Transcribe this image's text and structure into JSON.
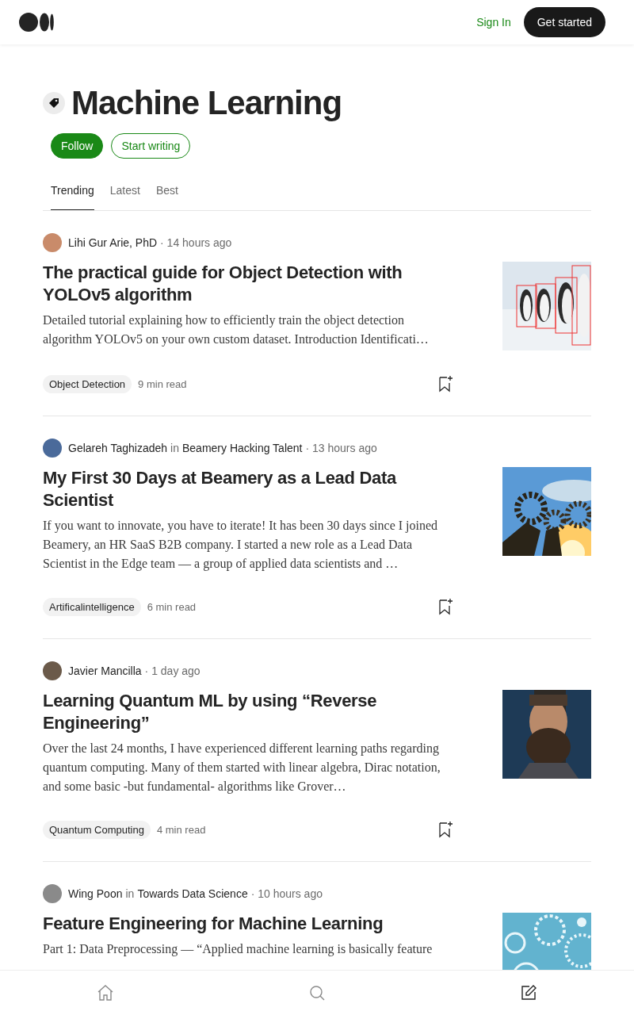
{
  "header": {
    "sign_in": "Sign In",
    "get_started": "Get started"
  },
  "topic": {
    "title": "Machine Learning",
    "follow": "Follow",
    "start_writing": "Start writing"
  },
  "tabs": [
    {
      "label": "Trending",
      "selected": true
    },
    {
      "label": "Latest",
      "selected": false
    },
    {
      "label": "Best",
      "selected": false
    }
  ],
  "articles": [
    {
      "author": "Lihi Gur Arie, PhD",
      "time": "· 14 hours ago",
      "title": "The practical guide for Object Detection with YOLOv5 algorithm",
      "excerpt": "Detailed tutorial explaining how to efficiently train the object detection algorithm YOLOv5 on your own custom dataset. Introduction Identificati…",
      "tag": "Object Detection",
      "read_time": "9 min read"
    },
    {
      "author": "Gelareh Taghizadeh",
      "in_label": "in",
      "publication": "Beamery Hacking Talent",
      "time": "· 13 hours ago",
      "title": "My First 30 Days at Beamery as a Lead Data Scientist",
      "excerpt": "If you want to innovate, you have to iterate! It has been 30 days since I joined Beamery, an HR SaaS B2B company. I started a new role as a Lead Data Scientist in the Edge team — a group of applied data scientists and …",
      "tag": "Artificalintelligence",
      "read_time": "6 min read"
    },
    {
      "author": "Javier Mancilla",
      "time": "· 1 day ago",
      "title": "Learning Quantum ML by using “Reverse Engineering”",
      "excerpt": "Over the last 24 months, I have experienced different learning paths regarding quantum computing. Many of them started with linear algebra, Dirac notation, and some basic -but fundamental- algorithms like Grover…",
      "tag": "Quantum Computing",
      "read_time": "4 min read"
    },
    {
      "author": "Wing Poon",
      "in_label": "in",
      "publication": "Towards Data Science",
      "time": "· 10 hours ago",
      "title": "Feature Engineering for Machine Learning",
      "excerpt": "Part 1: Data Preprocessing — “Applied machine learning is basically feature"
    }
  ]
}
